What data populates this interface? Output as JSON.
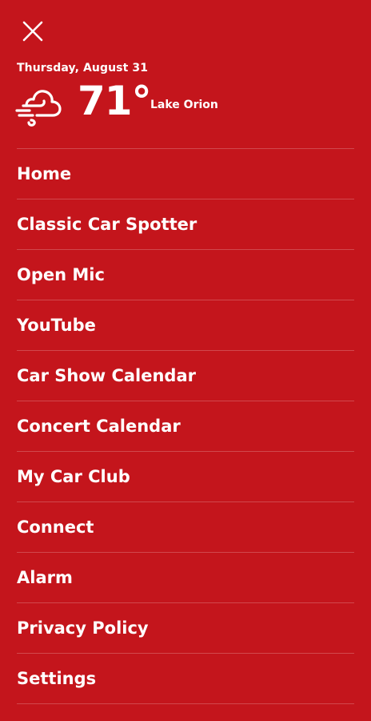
{
  "header": {
    "date": "Thursday, August 31",
    "temperature": "71°",
    "location": "Lake Orion",
    "weather_icon": "windy-cloud-icon",
    "close_icon": "close-icon"
  },
  "menu": {
    "items": [
      {
        "label": "Home"
      },
      {
        "label": "Classic Car Spotter"
      },
      {
        "label": "Open Mic"
      },
      {
        "label": "YouTube"
      },
      {
        "label": "Car Show Calendar"
      },
      {
        "label": "Concert Calendar"
      },
      {
        "label": "My Car Club"
      },
      {
        "label": "Connect"
      },
      {
        "label": "Alarm"
      },
      {
        "label": "Privacy Policy"
      },
      {
        "label": "Settings"
      }
    ]
  },
  "colors": {
    "background": "#c4151c",
    "text": "#ffffff"
  }
}
